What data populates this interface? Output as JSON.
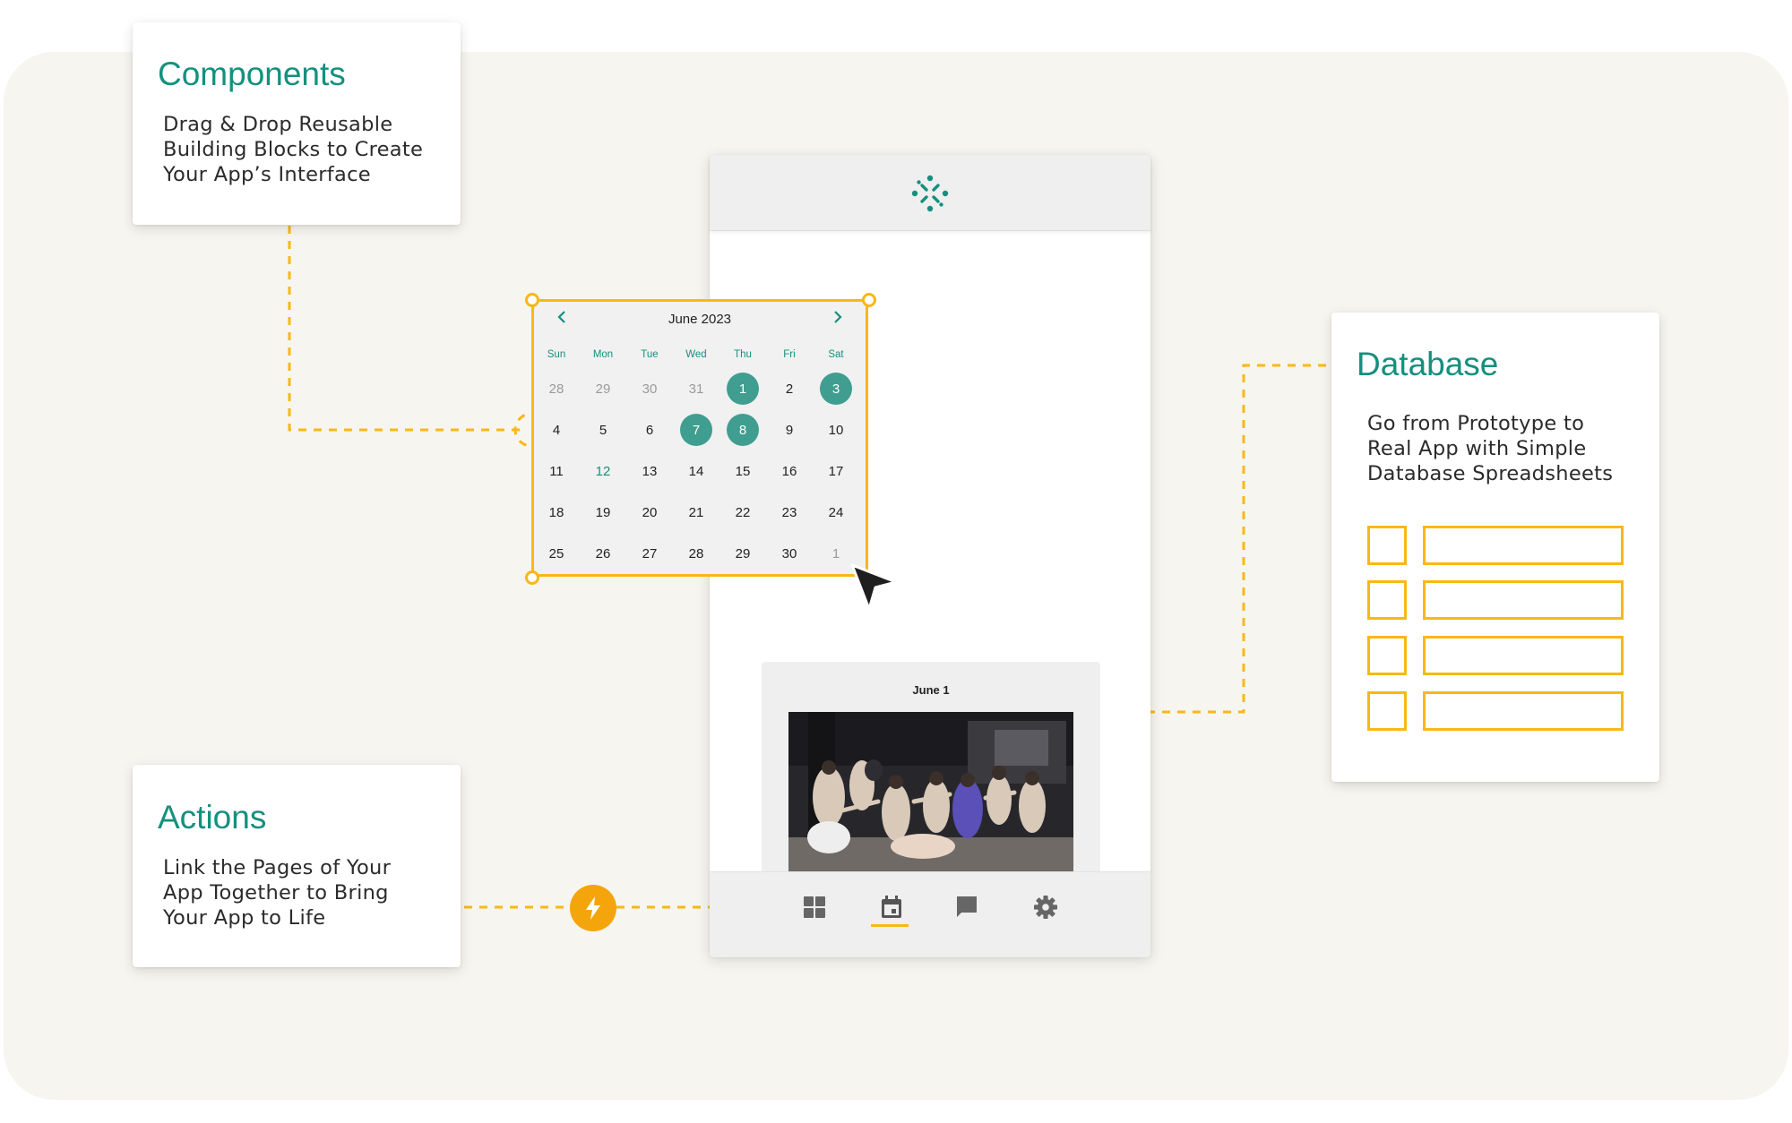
{
  "cards": {
    "components": {
      "title": "Components",
      "lines": [
        "Drag & Drop Reusable",
        "Building Blocks to Create",
        "Your App’s Interface"
      ]
    },
    "database": {
      "title": "Database",
      "lines": [
        "Go from Prototype to",
        "Real App with Simple",
        "Database Spreadsheets"
      ]
    },
    "actions": {
      "title": "Actions",
      "lines": [
        "Link the Pages of Your",
        "App Together to Bring",
        "Your App to Life"
      ]
    }
  },
  "calendar": {
    "title": "June 2023",
    "weekdays": [
      "Sun",
      "Mon",
      "Tue",
      "Wed",
      "Thu",
      "Fri",
      "Sat"
    ],
    "weeks": [
      [
        "28",
        "29",
        "30",
        "31",
        "1",
        "2",
        "3"
      ],
      [
        "4",
        "5",
        "6",
        "7",
        "8",
        "9",
        "10"
      ],
      [
        "11",
        "12",
        "13",
        "14",
        "15",
        "16",
        "17"
      ],
      [
        "18",
        "19",
        "20",
        "21",
        "22",
        "23",
        "24"
      ],
      [
        "25",
        "26",
        "27",
        "28",
        "29",
        "30",
        "1"
      ]
    ],
    "muted_days": [
      "28",
      "29",
      "30",
      "31"
    ],
    "trailing_muted_days": [
      "1"
    ],
    "selected_days": [
      "1",
      "3",
      "7",
      "8"
    ],
    "today": "12"
  },
  "event": {
    "title": "June 1"
  },
  "bottom_nav": {
    "items": [
      "grid-icon",
      "calendar-icon",
      "chat-icon",
      "gear-icon"
    ],
    "active": "calendar-icon"
  },
  "colors": {
    "accent": "#14907e",
    "selection": "#f8b816",
    "bolt": "#f5a50c",
    "background": "#f7f5ef"
  }
}
